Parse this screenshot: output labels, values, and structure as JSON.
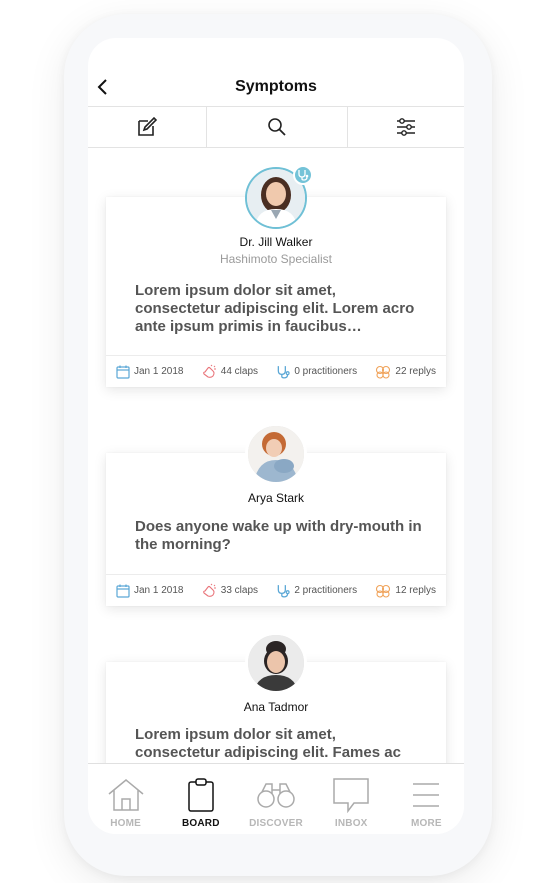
{
  "header": {
    "title": "Symptoms"
  },
  "toolbar": {
    "icons": [
      "compose-icon",
      "search-icon",
      "filter-icon"
    ]
  },
  "posts": [
    {
      "author": "Dr. Jill Walker",
      "role": "Hashimoto Specialist",
      "verified_badge": "stethoscope-icon",
      "text": "Lorem ipsum dolor sit amet, consectetur adipiscing elit. Lorem acro ante ipsum primis in faucibus…",
      "date": "Jan 1 2018",
      "claps": "44 claps",
      "practitioners": "0 practitioners",
      "replys": "22 replys"
    },
    {
      "author": "Arya Stark",
      "text": "Does anyone wake up with dry-mouth in the morning?",
      "date": "Jan 1 2018",
      "claps": "33 claps",
      "practitioners": "2 practitioners",
      "replys": "12 replys"
    },
    {
      "author": "Ana Tadmor",
      "text": "Lorem ipsum dolor sit amet, consectetur adipiscing elit. Fames ac"
    }
  ],
  "nav": {
    "items": [
      {
        "label": "HOME",
        "icon": "home-icon"
      },
      {
        "label": "BOARD",
        "icon": "clipboard-icon",
        "active": true
      },
      {
        "label": "DISCOVER",
        "icon": "binoculars-icon"
      },
      {
        "label": "INBOX",
        "icon": "chat-icon"
      },
      {
        "label": "MORE",
        "icon": "menu-icon"
      }
    ]
  },
  "colors": {
    "accent": "#74c3d8",
    "clap": "#e9747a",
    "reply": "#f0a35a",
    "calendar": "#5aa7d6"
  }
}
